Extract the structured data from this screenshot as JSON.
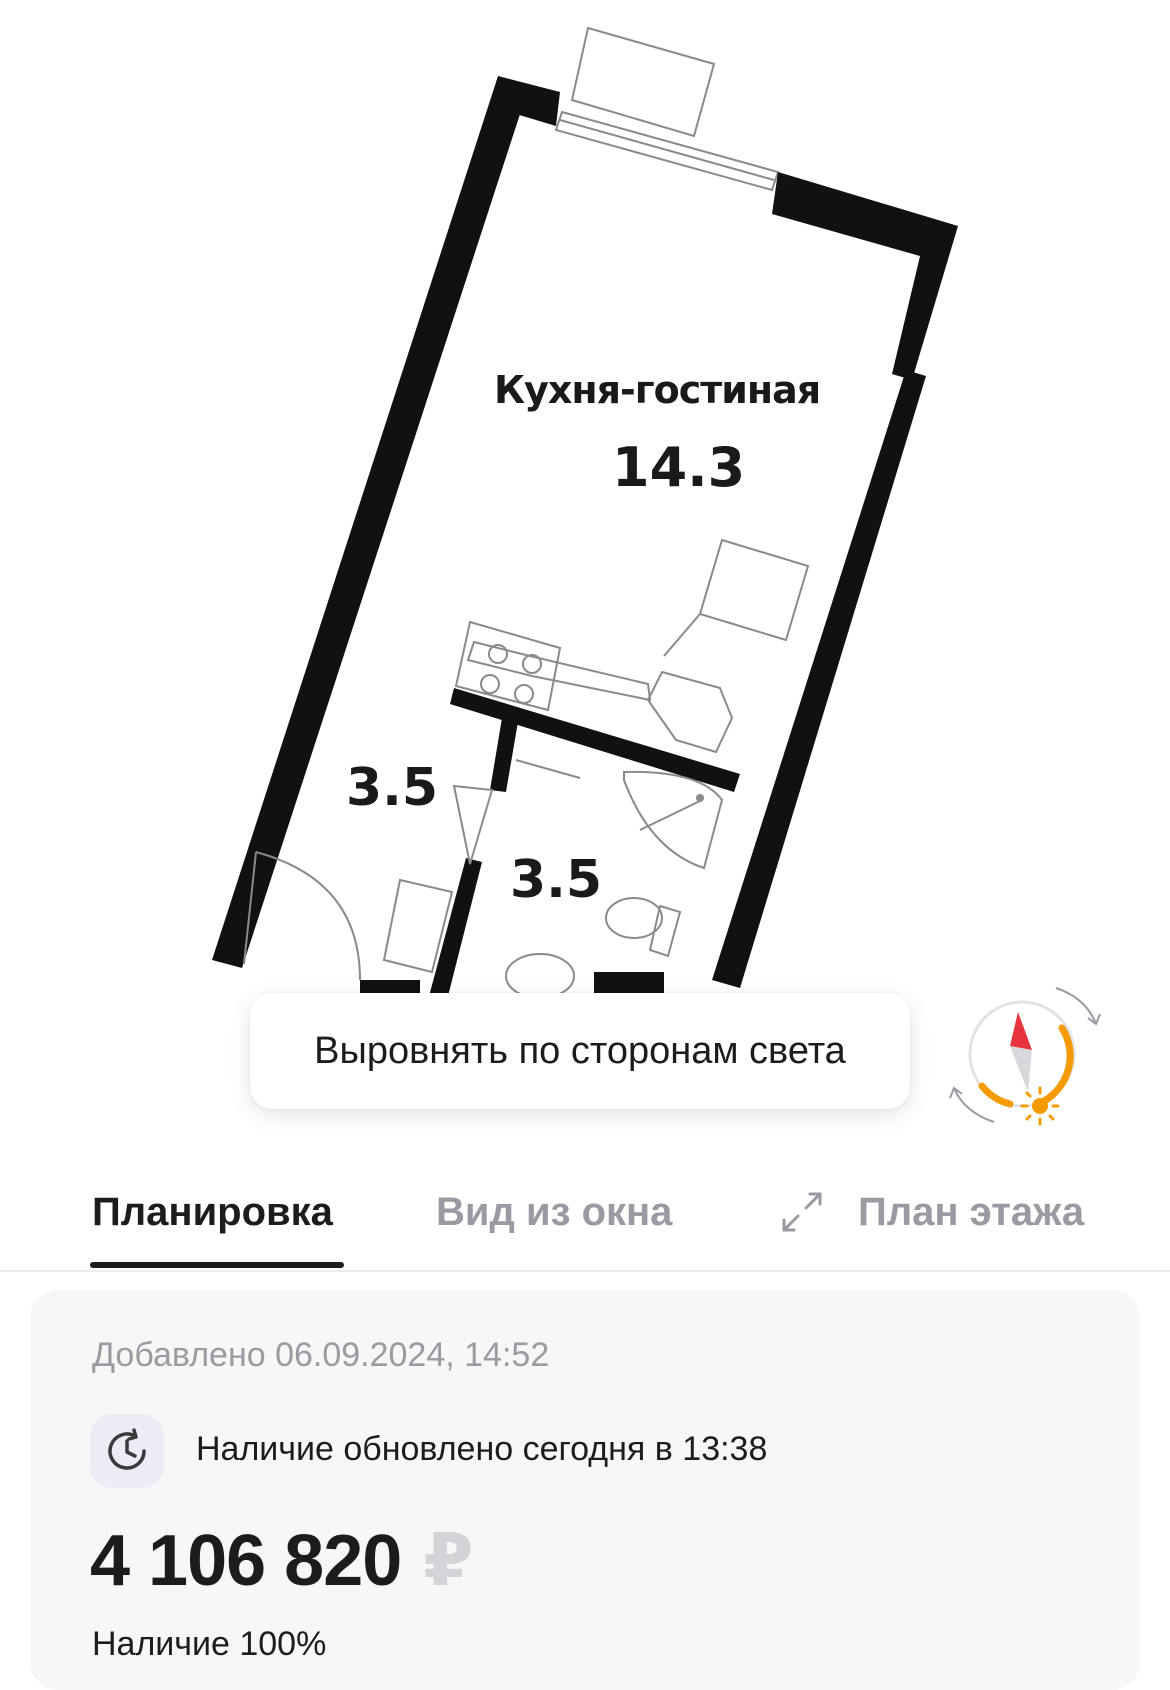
{
  "floorplan": {
    "room_kitchen_label": "Кухня-гостиная",
    "room_kitchen_area": "14.3",
    "room_hall_area": "3.5",
    "room_bath_area": "3.5"
  },
  "align_button": {
    "label": "Выровнять по сторонам света"
  },
  "compass": {
    "icon": "compass-icon"
  },
  "tabs": [
    {
      "label": "Планировка",
      "active": true
    },
    {
      "label": "Вид из окна",
      "active": false
    },
    {
      "label": "План этажа",
      "active": false
    }
  ],
  "listing": {
    "added": "Добавлено 06.09.2024, 14:52",
    "availability": "Наличие обновлено сегодня в 13:38",
    "price": "4 106 820",
    "currency": "₽",
    "partial_line": "Наличие 100%"
  },
  "colors": {
    "accent": "#f59b00",
    "compass_needle": "#e8343c",
    "text_primary": "#1c1c1e",
    "text_muted": "#9a9aa2"
  }
}
